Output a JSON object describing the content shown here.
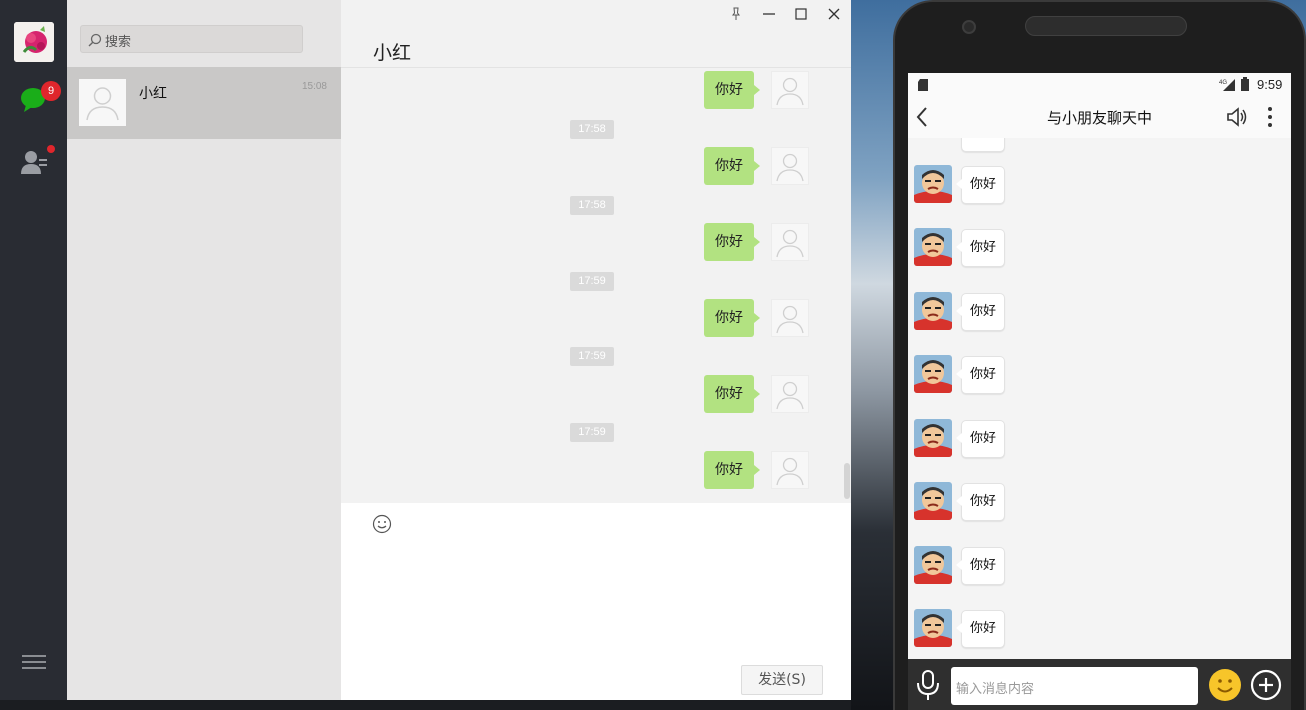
{
  "wechat": {
    "nav": {
      "unread_badge": "9"
    },
    "search": {
      "placeholder": "搜索"
    },
    "conversations": [
      {
        "name": "小红",
        "time": "15:08"
      }
    ],
    "chat": {
      "title": "小红",
      "messages": [
        {
          "text": "你好"
        },
        {
          "time": "17:58",
          "text": "你好"
        },
        {
          "time": "17:58",
          "text": "你好"
        },
        {
          "time": "17:59",
          "text": "你好"
        },
        {
          "time": "17:59",
          "text": "你好"
        },
        {
          "time": "17:59",
          "text": "你好"
        }
      ],
      "send_label": "发送(S)"
    }
  },
  "phone": {
    "status": {
      "clock": "9:59",
      "network": "4G"
    },
    "title": "与小朋友聊天中",
    "messages": [
      "你好",
      "你好",
      "你好",
      "你好",
      "你好",
      "你好",
      "你好",
      "你好"
    ],
    "input_placeholder": "输入消息内容"
  },
  "colors": {
    "sent_bubble": "#b2e281",
    "badge": "#e0262c",
    "nav_bg": "#292c33"
  }
}
